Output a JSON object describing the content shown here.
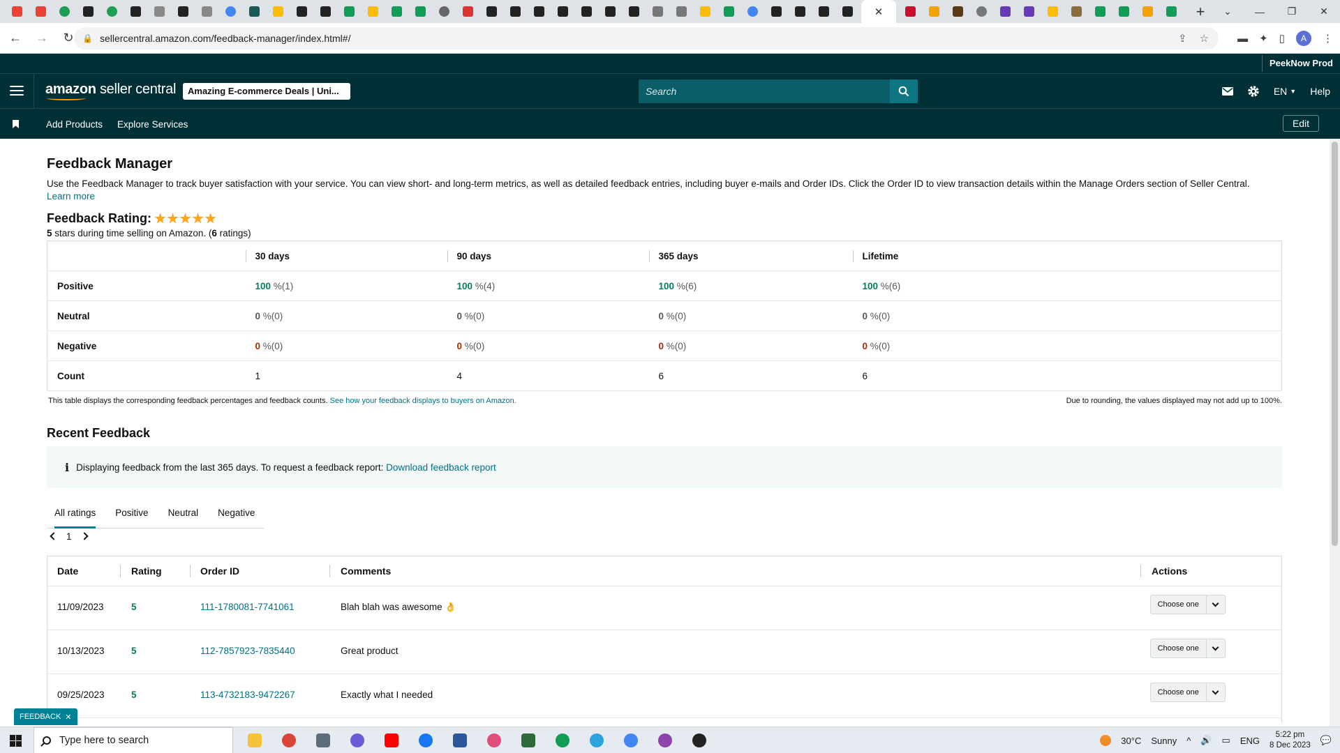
{
  "browser": {
    "url": "sellercentral.amazon.com/feedback-manager/index.html#/",
    "tab_close_glyph": "✕"
  },
  "header": {
    "account_name": "PeekNow Prod",
    "logo_prefix": "amazon",
    "logo_suffix": "seller central",
    "store_selector": "Amazing E-commerce Deals | Uni...",
    "search_placeholder": "Search",
    "language": "EN",
    "help": "Help",
    "icons": [
      "menu-icon",
      "mail-icon",
      "gear-icon",
      "search-icon"
    ]
  },
  "nav": {
    "links": [
      "Add Products",
      "Explore Services"
    ],
    "edit_label": "Edit"
  },
  "page": {
    "title": "Feedback Manager",
    "intro": "Use the Feedback Manager to track buyer satisfaction with your service. You can view short- and long-term metrics, as well as detailed feedback entries, including buyer e-mails and Order IDs. Click the Order ID to view transaction details within the Manage Orders section of Seller Central.",
    "learn_more": "Learn more",
    "rating_title": "Feedback Rating:",
    "rating_stars": 5,
    "rating_summary_value": "5",
    "rating_summary_text": " stars during time selling on Amazon. (",
    "rating_summary_count": "6",
    "rating_summary_suffix": " ratings)"
  },
  "metrics": {
    "columns": [
      "30 days",
      "90 days",
      "365 days",
      "Lifetime"
    ],
    "rows": {
      "positive": {
        "label": "Positive",
        "values": [
          "100",
          "100",
          "100",
          "100"
        ],
        "counts": [
          "(1)",
          "(4)",
          "(6)",
          "(6)"
        ]
      },
      "neutral": {
        "label": "Neutral",
        "values": [
          "0",
          "0",
          "0",
          "0"
        ],
        "counts": [
          "(0)",
          "(0)",
          "(0)",
          "(0)"
        ]
      },
      "negative": {
        "label": "Negative",
        "values": [
          "0",
          "0",
          "0",
          "0"
        ],
        "counts": [
          "(0)",
          "(0)",
          "(0)",
          "(0)"
        ]
      },
      "count": {
        "label": "Count",
        "values": [
          "1",
          "4",
          "6",
          "6"
        ]
      }
    },
    "percent_sign": " %",
    "note": "This table displays the corresponding feedback percentages and feedback counts.",
    "note_link": "See how your feedback displays to buyers on Amazon.",
    "rounding_note": "Due to rounding, the values displayed may not add up to 100%."
  },
  "recent": {
    "title": "Recent Feedback",
    "info_icon": "i",
    "info_text": "Displaying feedback from the last 365 days. To request a feedback report:",
    "info_link": "Download feedback report",
    "tabs": [
      "All ratings",
      "Positive",
      "Neutral",
      "Negative"
    ],
    "page_number": "1",
    "columns": [
      "Date",
      "Rating",
      "Order ID",
      "Comments",
      "Actions"
    ],
    "rows": [
      {
        "date": "11/09/2023",
        "rating": "5",
        "order_id": "111-1780081-7741061",
        "comment": "Blah blah was awesome 👌",
        "action": "Choose one"
      },
      {
        "date": "10/13/2023",
        "rating": "5",
        "order_id": "112-7857923-7835440",
        "comment": "Great product",
        "action": "Choose one"
      },
      {
        "date": "09/25/2023",
        "rating": "5",
        "order_id": "113-4732183-9472267",
        "comment": "Exactly what I needed",
        "action": "Choose one"
      }
    ]
  },
  "feedback_tab": {
    "label": "FEEDBACK",
    "close": "✕"
  },
  "taskbar": {
    "search_placeholder": "Type here to search",
    "temperature": "30°C",
    "weather": "Sunny",
    "language": "ENG",
    "time": "5:22 pm",
    "date": "8 Dec 2023"
  },
  "colors": {
    "header_bg": "#002f36",
    "link": "#007185",
    "positive": "#067d62",
    "negative": "#b12704",
    "star": "#ffa41c",
    "tab_accent": "#008296"
  }
}
